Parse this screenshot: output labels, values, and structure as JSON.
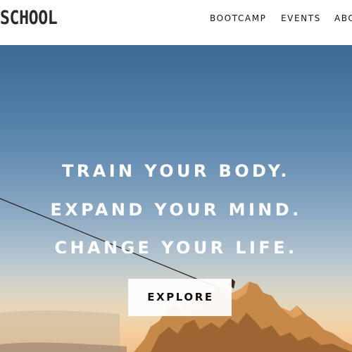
{
  "header": {
    "logo_text": "SCHOOL",
    "nav": [
      {
        "label": "BOOTCAMP"
      },
      {
        "label": "EVENTS"
      },
      {
        "label": "ABO"
      }
    ]
  },
  "hero": {
    "headline": [
      "TRAIN YOUR BODY.",
      "EXPAND YOUR MIND.",
      "CHANGE YOUR LIFE."
    ],
    "cta_label": "EXPLORE"
  },
  "colors": {
    "sky_top": "#3d6a94",
    "sky_horizon": "#f1c08a",
    "rock": "#c98a4a",
    "text_light": "#ffffff",
    "text_dark": "#111111"
  }
}
